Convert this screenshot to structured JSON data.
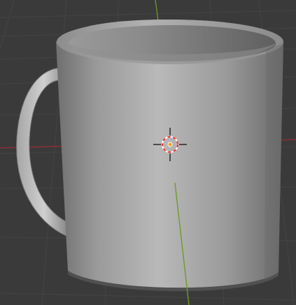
{
  "viewport": {
    "label": "3D viewport",
    "colors": {
      "background": "#3a3a3a",
      "grid": "#444444",
      "x_axis": "#8a2f38",
      "y_axis": "#6f9a2a",
      "mesh_light": "#b7b7b7",
      "mesh_mid": "#8d8d8d",
      "mesh_dark": "#6e6e6e",
      "cursor_red": "#ff2a2a",
      "cursor_white": "#ffffff",
      "origin_orange": "#f39b1f"
    },
    "object": {
      "name_icon": "mug-mesh"
    },
    "cursor": {
      "icon": "3d-cursor-icon"
    }
  }
}
